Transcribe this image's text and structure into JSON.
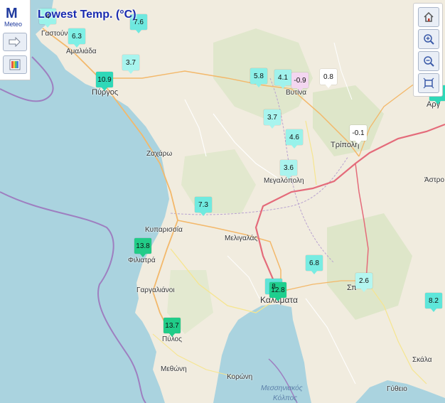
{
  "title": "Lowest Temp. (°C)",
  "logo": {
    "text": "Meteo"
  },
  "left_buttons": [
    "arrow-right-icon",
    "legend-palette-icon"
  ],
  "right_buttons": [
    "home-icon",
    "zoom-in-icon",
    "zoom-out-icon",
    "full-extent-icon"
  ],
  "places": [
    {
      "id": "gastouni",
      "name": "Γαστούνι"
    },
    {
      "id": "amaliada",
      "name": "Αμαλιάδα"
    },
    {
      "id": "pyrgos",
      "name": "Πύργος"
    },
    {
      "id": "vytina",
      "name": "Βυτίνα"
    },
    {
      "id": "tripoli",
      "name": "Τρίπολη"
    },
    {
      "id": "argos",
      "name": "Αργ"
    },
    {
      "id": "zacharo",
      "name": "Ζαχάρω"
    },
    {
      "id": "megalopoli",
      "name": "Μεγαλόπολη"
    },
    {
      "id": "astros",
      "name": "Άστρο"
    },
    {
      "id": "kyparissia",
      "name": "Κυπαρισσία"
    },
    {
      "id": "meligalas",
      "name": "Μελιγαλάς"
    },
    {
      "id": "filiatra",
      "name": "Φιλιατρά"
    },
    {
      "id": "sparti",
      "name": "Σπ"
    },
    {
      "id": "gargalianoi",
      "name": "Γαργαλιάνοι"
    },
    {
      "id": "kalamata",
      "name": "Καλαματα"
    },
    {
      "id": "pylos",
      "name": "Πύλος"
    },
    {
      "id": "skala",
      "name": "Σκάλα"
    },
    {
      "id": "methoni",
      "name": "Μεθώνη"
    },
    {
      "id": "koroni",
      "name": "Κορώνη"
    },
    {
      "id": "gytheio",
      "name": "Γύθειο"
    }
  ],
  "sea_label": {
    "line1": "Μεσσηνιακός",
    "line2": "Κόλπος"
  },
  "stations": [
    {
      "value": "4",
      "color": "#9af3ea"
    },
    {
      "value": "6.3",
      "color": "#7ff0e6"
    },
    {
      "value": "7.6",
      "color": "#6ee8df"
    },
    {
      "value": "3.7",
      "color": "#a8f4ee"
    },
    {
      "value": "10.9",
      "color": "#2fd8b8"
    },
    {
      "value": "5.8",
      "color": "#8cf0e8"
    },
    {
      "value": "4.1",
      "color": "#a0f2ec"
    },
    {
      "value": "-0.9",
      "color": "#f3d6f0"
    },
    {
      "value": "0.8",
      "color": "#ffffff"
    },
    {
      "value": "3.7",
      "color": "#a8f4ee"
    },
    {
      "value": "4.6",
      "color": "#98f2ea"
    },
    {
      "value": "-0.1",
      "color": "#ffffff"
    },
    {
      "value": "3.6",
      "color": "#aaf4ee"
    },
    {
      "value": "7.3",
      "color": "#70eadf"
    },
    {
      "value": "13.8",
      "color": "#22cc88"
    },
    {
      "value": "6.8",
      "color": "#78ecE2"
    },
    {
      "value": "8",
      "color": "#5fe4d8"
    },
    {
      "value": "12.8",
      "color": "#1fcf8e"
    },
    {
      "value": "2.6",
      "color": "#b4f6f0"
    },
    {
      "value": "8.2",
      "color": "#5ee6da"
    },
    {
      "value": "13.7",
      "color": "#20cc88"
    },
    {
      "value": "",
      "color": "#2fd8b8"
    }
  ]
}
